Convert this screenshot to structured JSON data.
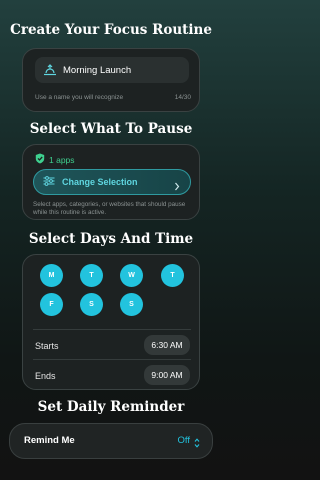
{
  "routine": {
    "heading": "Create Your Focus Routine",
    "name_value": "Morning Launch",
    "hint": "Use a name you will recognize",
    "char_count": "14/30"
  },
  "pause": {
    "heading": "Select What To Pause",
    "apps_count": "1 apps",
    "change_label": "Change Selection",
    "hint": "Select apps, categories, or websites that should pause while this routine is active."
  },
  "schedule": {
    "heading": "Select Days And Time",
    "days": [
      "M",
      "T",
      "W",
      "T",
      "F",
      "S",
      "S"
    ],
    "starts_label": "Starts",
    "starts_value": "6:30 AM",
    "ends_label": "Ends",
    "ends_value": "9:00 AM"
  },
  "reminder": {
    "heading": "Set Daily Reminder",
    "label": "Remind Me",
    "value": "Off"
  },
  "colors": {
    "accent": "#22c3de",
    "success": "#3ed08f"
  },
  "icons": {
    "name": "sunrise-icon",
    "apps": "shield-check-icon",
    "change": "sliders-icon",
    "chevron": "chevron-right-icon",
    "stepper": "chevron-up-down-icon"
  }
}
